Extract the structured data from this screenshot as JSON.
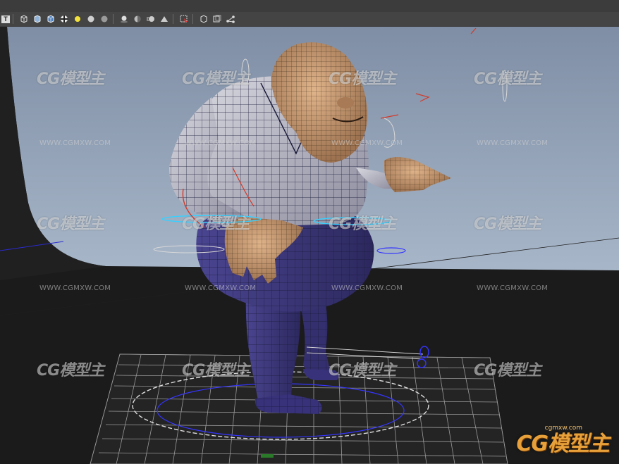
{
  "toolbar": {
    "text_mode_label": "T",
    "icons": [
      "wireframe-cube-icon",
      "smooth-cube-icon",
      "textured-cube-icon",
      "checker-icon",
      "light-bulb-icon",
      "sphere-icon",
      "sphere-dark-icon",
      "shadow-sphere-icon",
      "ao-sphere-icon",
      "motion-blur-icon",
      "aa-icon",
      "select-icon",
      "isolate-icon",
      "xray-icon",
      "joints-icon"
    ]
  },
  "viewport": {
    "watermark_text": "CG模型主",
    "watermark_url": "WWW.CGMXW.COM",
    "corner_logo_text": "CG模型主",
    "corner_logo_url": "cgmxw.com"
  },
  "colors": {
    "backdrop_top": "#8a98ad",
    "backdrop_bottom": "#a3b3c6",
    "grid": "#9a9a9a",
    "wire_dark": "#1a1a3a",
    "pants": "#3b3678",
    "shirt": "#c9c9d3",
    "skin": "#c79c73",
    "rig_blue": "#3b3bff",
    "rig_red": "#d23a2a"
  }
}
